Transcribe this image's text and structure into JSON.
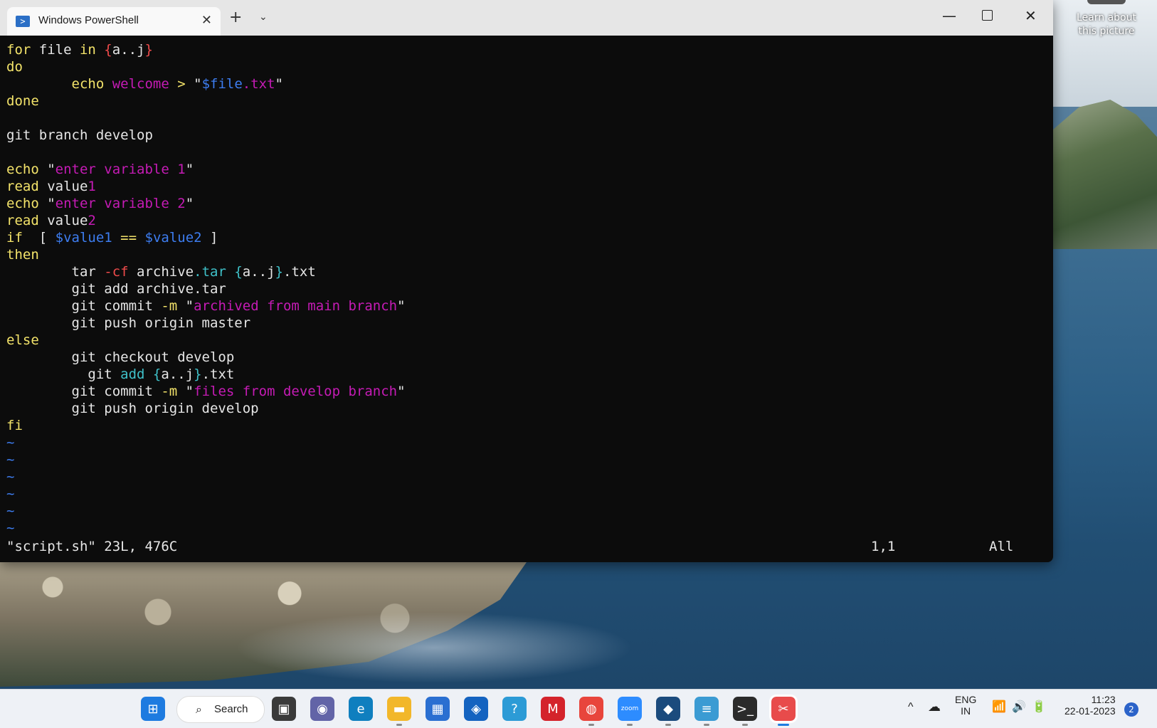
{
  "desktop": {
    "learn_text": "Learn about this picture"
  },
  "window": {
    "tab_title": "Windows PowerShell",
    "tab_icon": "powershell-icon",
    "close_glyph": "✕",
    "new_tab_glyph": "+",
    "dropdown_glyph": "⌄",
    "minimize_glyph": "—",
    "close_window_glyph": "✕"
  },
  "editor": {
    "status_file": "\"script.sh\" 23L, 476C",
    "status_pos": "1,1",
    "status_all": "All",
    "lines": [
      [
        [
          "y",
          "for "
        ],
        [
          "",
          "file "
        ],
        [
          "y",
          "in "
        ],
        [
          "r",
          "{"
        ],
        [
          "",
          "a..j"
        ],
        [
          "r",
          "}"
        ]
      ],
      [
        [
          "y",
          "do"
        ]
      ],
      [
        [
          "",
          "        "
        ],
        [
          "y",
          "echo "
        ],
        [
          "m",
          "welcome "
        ],
        [
          "y",
          "> "
        ],
        [
          "",
          "\""
        ],
        [
          "b",
          "$file"
        ],
        [
          "m",
          ".txt"
        ],
        [
          "",
          "\""
        ]
      ],
      [
        [
          "y",
          "done"
        ]
      ],
      [],
      [
        [
          "",
          "git branch develop"
        ]
      ],
      [],
      [
        [
          "y",
          "echo "
        ],
        [
          "",
          "\""
        ],
        [
          "m",
          "enter variable 1"
        ],
        [
          "",
          "\""
        ]
      ],
      [
        [
          "y",
          "read "
        ],
        [
          "",
          "value"
        ],
        [
          "m",
          "1"
        ]
      ],
      [
        [
          "y",
          "echo "
        ],
        [
          "",
          "\""
        ],
        [
          "m",
          "enter variable 2"
        ],
        [
          "",
          "\""
        ]
      ],
      [
        [
          "y",
          "read "
        ],
        [
          "",
          "value"
        ],
        [
          "m",
          "2"
        ]
      ],
      [
        [
          "y",
          "if  "
        ],
        [
          "",
          "[ "
        ],
        [
          "b",
          "$value1"
        ],
        [
          "y",
          " == "
        ],
        [
          "b",
          "$value2"
        ],
        [
          "",
          " ]"
        ]
      ],
      [
        [
          "y",
          "then"
        ]
      ],
      [
        [
          "",
          "        tar "
        ],
        [
          "r",
          "-cf "
        ],
        [
          "",
          "archive"
        ],
        [
          "c",
          ".tar "
        ],
        [
          "c",
          "{"
        ],
        [
          "",
          "a..j"
        ],
        [
          "c",
          "}"
        ],
        [
          "",
          ".txt"
        ]
      ],
      [
        [
          "",
          "        git add archive.tar"
        ]
      ],
      [
        [
          "",
          "        git commit "
        ],
        [
          "y",
          "-m "
        ],
        [
          "",
          "\""
        ],
        [
          "m",
          "archived from main branch"
        ],
        [
          "",
          "\""
        ]
      ],
      [
        [
          "",
          "        git push origin master"
        ]
      ],
      [
        [
          "y",
          "else"
        ]
      ],
      [
        [
          "",
          "        git checkout develop"
        ]
      ],
      [
        [
          "",
          "          git "
        ],
        [
          "c",
          "add "
        ],
        [
          "c",
          "{"
        ],
        [
          "",
          "a..j"
        ],
        [
          "c",
          "}"
        ],
        [
          "",
          ".txt"
        ]
      ],
      [
        [
          "",
          "        git commit "
        ],
        [
          "y",
          "-m "
        ],
        [
          "",
          "\""
        ],
        [
          "m",
          "files from develop branch"
        ],
        [
          "",
          "\""
        ]
      ],
      [
        [
          "",
          "        git push origin develop"
        ]
      ],
      [
        [
          "y",
          "fi"
        ]
      ],
      [
        [
          "t",
          "~"
        ]
      ],
      [
        [
          "t",
          "~"
        ]
      ],
      [
        [
          "t",
          "~"
        ]
      ],
      [
        [
          "t",
          "~"
        ]
      ],
      [
        [
          "t",
          "~"
        ]
      ],
      [
        [
          "t",
          "~"
        ]
      ]
    ]
  },
  "taskbar": {
    "search_label": "Search",
    "items": [
      {
        "name": "windows-start-icon",
        "glyph": "⊞",
        "bg": "#1e7be0"
      },
      {
        "name": "task-view-icon",
        "glyph": "▣",
        "bg": "#3a3a3a"
      },
      {
        "name": "teams-chat-icon",
        "glyph": "◉",
        "bg": "#6264a7"
      },
      {
        "name": "edge-icon",
        "glyph": "e",
        "bg": "#0f7fbf"
      },
      {
        "name": "file-explorer-icon",
        "glyph": "▬",
        "bg": "#f2b72a"
      },
      {
        "name": "microsoft-store-icon",
        "glyph": "▦",
        "bg": "#2a6fd1"
      },
      {
        "name": "vpn-icon",
        "glyph": "◈",
        "bg": "#1463c0"
      },
      {
        "name": "get-help-icon",
        "glyph": "?",
        "bg": "#2c9bd6"
      },
      {
        "name": "mcafee-icon",
        "glyph": "M",
        "bg": "#d4232b"
      },
      {
        "name": "chrome-icon",
        "glyph": "◍",
        "bg": "#e8453c"
      },
      {
        "name": "zoom-icon",
        "glyph": "zoom",
        "bg": "#2d8cff"
      },
      {
        "name": "virtualbox-icon",
        "glyph": "◆",
        "bg": "#1b4b7d"
      },
      {
        "name": "notepad-icon",
        "glyph": "≡",
        "bg": "#3b9bd3"
      },
      {
        "name": "terminal-icon",
        "glyph": ">_",
        "bg": "#2b2b2b"
      },
      {
        "name": "snipping-tool-icon",
        "glyph": "✂",
        "bg": "#e84b4b"
      }
    ],
    "tray": {
      "chevron": "^",
      "cloud": "☁",
      "lang_top": "ENG",
      "lang_bottom": "IN",
      "wifi": "📶",
      "volume": "🔊",
      "battery": "🔋",
      "time": "11:23",
      "date": "22-01-2023",
      "badge": "2"
    }
  }
}
